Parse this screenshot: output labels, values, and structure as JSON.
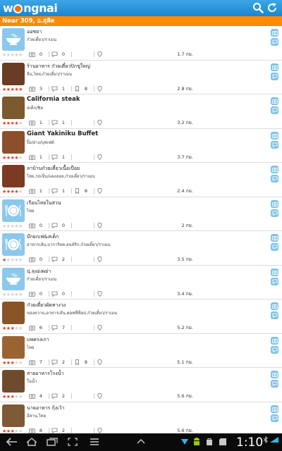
{
  "app": {
    "logo_text": "wongnai",
    "brand_color": "#1a86d0",
    "accent_color": "#ff8a00"
  },
  "location": "Near 309, อ.สุคิต",
  "restaurants": [
    {
      "name": "ออชยา",
      "category": "ก๋วยเตี๋ยว/ราเมน",
      "stars": 0,
      "photos": "0",
      "reviews": "0",
      "checkins": "",
      "distance": "1.7 กม.",
      "thumb": "placeholder-bowl"
    },
    {
      "name": "ร้านอาหาร ก๋วยเตี๋ยวปิกขู่ใหญ่",
      "category": "จีน,ไทย,ก๋วยเตี๋ยว/ราเมน",
      "stars": 5,
      "photos": "3",
      "reviews": "1",
      "checkins": "8",
      "distance": "2.8 กม.",
      "thumb": "photo"
    },
    {
      "name": "California steak",
      "category": "สเต็ก/ฟิล",
      "stars": 4,
      "photos": "1",
      "reviews": "1",
      "checkins": "",
      "distance": "3.2 กม.",
      "thumb": "photo",
      "bold": true
    },
    {
      "name": "Giant Yakiniku Buffet",
      "category": "ปิ้ง/ย่าง/บุฟเฟต์",
      "stars": 4,
      "photos": "1",
      "reviews": "1",
      "checkins": "",
      "distance": "3.7 กม.",
      "thumb": "photo",
      "bold": true
    },
    {
      "name": "ลาบ้านก๋วยเตี๋ยวเนื้อเปื่อย",
      "category": "ไทย,รถเข็น/แผงลอย,ก๋วยเตี๋ยว/ราเมน",
      "stars": 4,
      "photos": "1",
      "reviews": "1",
      "checkins": "8",
      "distance": "2.4 กม.",
      "thumb": "photo"
    },
    {
      "name": "เรือนไทยในสวน",
      "category": "ไทย",
      "stars": 0,
      "photos": "0",
      "reviews": "0",
      "checkins": "",
      "distance": "2 กม.",
      "thumb": "placeholder-plate"
    },
    {
      "name": "บ๊กยกเฟ&สเต็ก",
      "category": "อาหารเส้น,บาการิยท,อนห์ริก,ก๋วยเตี๋ยว/ราเมน",
      "stars": 1,
      "photos": "0",
      "reviews": "2",
      "checkins": "",
      "distance": "3.5 กม.",
      "thumb": "placeholder-plate"
    },
    {
      "name": "ปุ.ลุงอ่งผย่า",
      "category": "ก๋วยเตี๋ยว/ราเมน",
      "stars": 0,
      "photos": "0",
      "reviews": "0",
      "checkins": "",
      "distance": "3.4 กม.",
      "thumb": "placeholder-bowl"
    },
    {
      "name": "ก๋วยเตี๋ยวผัดทางวง",
      "category": "ของหวาน,อาหารเส้น,คอฟฟี่ช็อป,ก๋วยเตี๋ยว/ราเมน",
      "stars": 3,
      "photos": "6",
      "reviews": "7",
      "checkins": "",
      "distance": "5.2 กม.",
      "thumb": "photo"
    },
    {
      "name": "แพครงเกา",
      "category": "ไทย",
      "stars": 3,
      "photos": "7",
      "reviews": "2",
      "checkins": "8",
      "distance": "5.1 กม.",
      "thumb": "photo"
    },
    {
      "name": "สายอาหารโรงน้ำ",
      "category": "ในน้ำ",
      "stars": 3,
      "photos": "4",
      "reviews": "2",
      "checkins": "",
      "distance": "5.6 กม.",
      "thumb": "photo"
    },
    {
      "name": "นายอาหาร กุ้งเว้า",
      "category": "อีสาน,ไทย",
      "stars": 3,
      "photos": "8",
      "reviews": "2",
      "checkins": "",
      "distance": "5.6 กม.",
      "thumb": "photo"
    }
  ],
  "system": {
    "clock": "1:10"
  }
}
